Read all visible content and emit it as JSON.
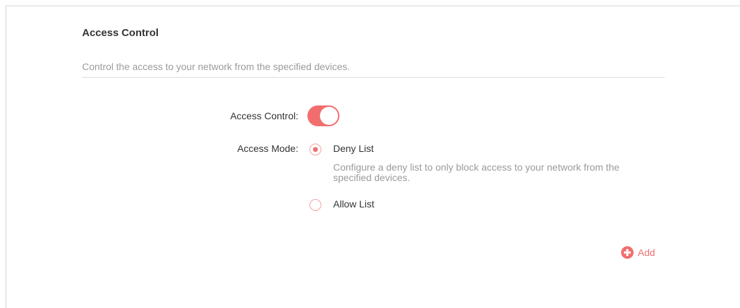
{
  "section": {
    "title": "Access Control",
    "description": "Control the access to your network from the specified devices."
  },
  "access_control": {
    "label": "Access Control:",
    "enabled": true
  },
  "access_mode": {
    "label": "Access Mode:",
    "selected": "deny",
    "options": [
      {
        "label": "Deny List",
        "help": "Configure a deny list to only block access to your network from the specified devices."
      },
      {
        "label": "Allow List"
      }
    ]
  },
  "actions": {
    "add_label": "Add",
    "add_icon": "plus-circle-icon"
  },
  "colors": {
    "accent": "#f26e6e",
    "radio_border": "#f4a2a2",
    "muted_text": "#9a9a9a",
    "text": "#333333"
  }
}
